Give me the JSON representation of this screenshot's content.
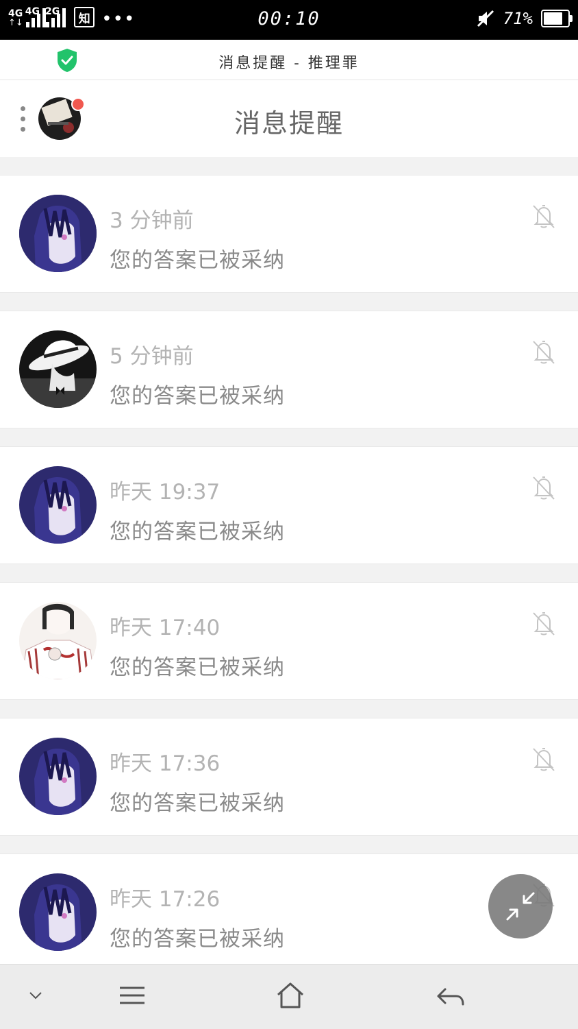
{
  "status_bar": {
    "net1": "4G",
    "net2": "4G",
    "net3": "2G",
    "app_badge": "知",
    "more": "•••",
    "time": "00:10",
    "battery_pct": "71%",
    "battery_level": 0.71
  },
  "browser": {
    "title": "消息提醒 - 推理罪"
  },
  "header": {
    "title": "消息提醒"
  },
  "notifications": [
    {
      "time": "3 分钟前",
      "message": "您的答案已被采纳",
      "avatar": "purple-hair-girl"
    },
    {
      "time": "5 分钟前",
      "message": "您的答案已被采纳",
      "avatar": "hat-gentleman"
    },
    {
      "time": "昨天 19:37",
      "message": "您的答案已被采纳",
      "avatar": "purple-hair-girl"
    },
    {
      "time": "昨天 17:40",
      "message": "您的答案已被采纳",
      "avatar": "girl-with-ribbon"
    },
    {
      "time": "昨天 17:36",
      "message": "您的答案已被采纳",
      "avatar": "purple-hair-girl"
    },
    {
      "time": "昨天 17:26",
      "message": "您的答案已被采纳",
      "avatar": "purple-hair-girl"
    }
  ],
  "colors": {
    "accent_green": "#22c36b",
    "badge_red": "#f0584f",
    "muted_text": "#b3b3b3"
  }
}
